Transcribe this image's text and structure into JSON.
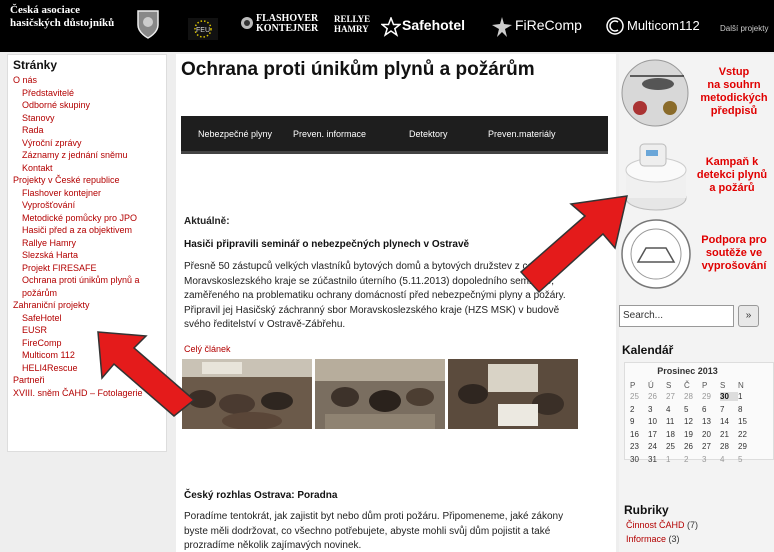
{
  "header": {
    "org_line1": "Česká asociace",
    "org_line2": "hasičských důstojníků",
    "partners": [
      "FLASHOVER",
      "KONTEJNER",
      "RELLYE",
      "HAMRY",
      "Safehotel",
      "FiReComp",
      "Multicom112"
    ],
    "eu_label": "FEU",
    "more_link": "Další projekty"
  },
  "sidebar": {
    "heading": "Stránky",
    "items": [
      {
        "label": "O nás",
        "level": 1
      },
      {
        "label": "Představitelé",
        "level": 2
      },
      {
        "label": "Odborné skupiny",
        "level": 2
      },
      {
        "label": "Stanovy",
        "level": 2
      },
      {
        "label": "Rada",
        "level": 2
      },
      {
        "label": "Výroční zprávy",
        "level": 2
      },
      {
        "label": "Záznamy z jednání sněmu",
        "level": 2
      },
      {
        "label": "Kontakt",
        "level": 2
      },
      {
        "label": "Projekty v České republice",
        "level": 1
      },
      {
        "label": "Flashover kontejner",
        "level": 2
      },
      {
        "label": "Vyprošťování",
        "level": 2
      },
      {
        "label": "Metodické pomůcky pro JPO",
        "level": 2
      },
      {
        "label": "Hasiči před a za objektivem",
        "level": 2
      },
      {
        "label": "Rallye Hamry",
        "level": 2
      },
      {
        "label": "Slezská Harta",
        "level": 2
      },
      {
        "label": "Projekt FIRESAFE",
        "level": 2
      },
      {
        "label": "Ochrana proti únikům plynů a",
        "level": 2
      },
      {
        "label": "požárům",
        "level": 2
      },
      {
        "label": "Zahraniční projekty",
        "level": 1
      },
      {
        "label": "SafeHotel",
        "level": 2
      },
      {
        "label": "EUSR",
        "level": 2
      },
      {
        "label": "FireComp",
        "level": 2
      },
      {
        "label": "Multicom 112",
        "level": 2
      },
      {
        "label": "HELI4Rescue",
        "level": 2
      },
      {
        "label": "Partneři",
        "level": 1
      },
      {
        "label": "XVIII. sněm ČAHD – Fotolagerie",
        "level": 1
      }
    ]
  },
  "main": {
    "title": "Ochrana proti únikům plynů a požárům",
    "menu": [
      "Nebezpečné plyny",
      "Preven. informace",
      "Detektory",
      "Preven.materiály"
    ],
    "section_label": "Aktuálně:",
    "article1": {
      "title": "Hasiči připravili seminář o nebezpečných plynech v Ostravě",
      "lines": [
        "Přesně 50 zástupců velkých vlastníků bytových domů a bytových družstev z celého",
        "Moravskoslezského kraje se zúčastnilo úterního (5.11.2013) dopoledního semináře,",
        "zaměřeného na problematiku ochrany domácností před nebezpečnými plyny a požáry.",
        "Připravil jej Hasičský záchranný sbor Moravskoslezského kraje (HZS MSK) v budově",
        "svého ředitelství v Ostravě-Zábřehu."
      ],
      "more": "Celý článek"
    },
    "article2": {
      "title": "Český rozhlas Ostrava: Poradna",
      "lines": [
        "Poradíme tentokrát, jak zajistit byt nebo dům proti požáru. Připomeneme, jaké zákony",
        "byste měli dodržovat, co všechno potřebujete, abyste mohli svůj dům pojistit a také",
        "prozradíme několik zajímavých novinek."
      ]
    }
  },
  "right": {
    "promo1": [
      "Vstup",
      "na souhrn",
      "metodických",
      "předpisů"
    ],
    "promo2": [
      "Kampaň k",
      "detekci plynů",
      "a požárů"
    ],
    "promo3": [
      "Podpora pro",
      "soutěže ve",
      "vyprošování"
    ],
    "search_placeholder": "Search...",
    "search_button": "»",
    "calendar_title": "Kalendář",
    "calendar": {
      "month": "Prosinec 2013",
      "weekdays": [
        "P",
        "Ú",
        "S",
        "Č",
        "P",
        "S",
        "N"
      ],
      "weeks": [
        [
          "25",
          "26",
          "27",
          "28",
          "29",
          "30",
          "1"
        ],
        [
          "2",
          "3",
          "4",
          "5",
          "6",
          "7",
          "8"
        ],
        [
          "9",
          "10",
          "11",
          "12",
          "13",
          "14",
          "15"
        ],
        [
          "16",
          "17",
          "18",
          "19",
          "20",
          "21",
          "22"
        ],
        [
          "23",
          "24",
          "25",
          "26",
          "27",
          "28",
          "29"
        ],
        [
          "30",
          "31",
          "1",
          "2",
          "3",
          "4",
          "5"
        ]
      ]
    },
    "categories_title": "Rubriky",
    "categories": [
      {
        "label": "Činnost ČAHD",
        "count": "(7)"
      },
      {
        "label": "Informace",
        "count": "(3)"
      }
    ]
  },
  "colors": {
    "accent": "#b30000",
    "promo": "#e00000",
    "header_bg": "#000000",
    "menu_bg": "#1e1e1e"
  }
}
